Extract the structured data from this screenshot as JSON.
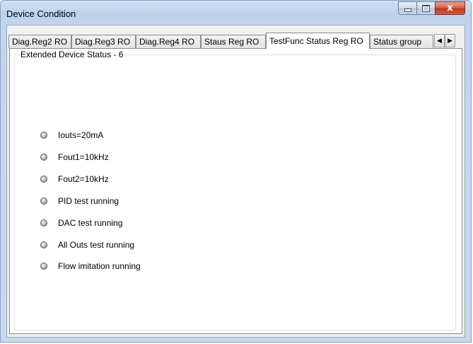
{
  "window": {
    "title": "Device Condition",
    "close_glyph": "x"
  },
  "tabs": [
    {
      "label": "Diag.Reg2 RO",
      "active": false
    },
    {
      "label": "Diag.Reg3 RO",
      "active": false
    },
    {
      "label": "Diag.Reg4 RO",
      "active": false
    },
    {
      "label": "Staus Reg RO",
      "active": false
    },
    {
      "label": "TestFunc Status Reg RO",
      "active": true
    },
    {
      "label": "Status group",
      "active": false
    }
  ],
  "tab_scroll": {
    "left_icon": "triangle-left-icon",
    "right_icon": "triangle-right-icon"
  },
  "group": {
    "title": "Extended Device Status - 6",
    "items": [
      {
        "label": "Iouts=20mA",
        "state": "off"
      },
      {
        "label": "Fout1=10kHz",
        "state": "off"
      },
      {
        "label": "Fout2=10kHz",
        "state": "off"
      },
      {
        "label": "PID test running",
        "state": "off"
      },
      {
        "label": "DAC test running",
        "state": "off"
      },
      {
        "label": "All Outs test running",
        "state": "off"
      },
      {
        "label": "Flow imitation running",
        "state": "off"
      }
    ]
  },
  "colors": {
    "frame": "#c3d6ee",
    "close_button": "#c3381c",
    "led_off": "#b8b8b8"
  }
}
